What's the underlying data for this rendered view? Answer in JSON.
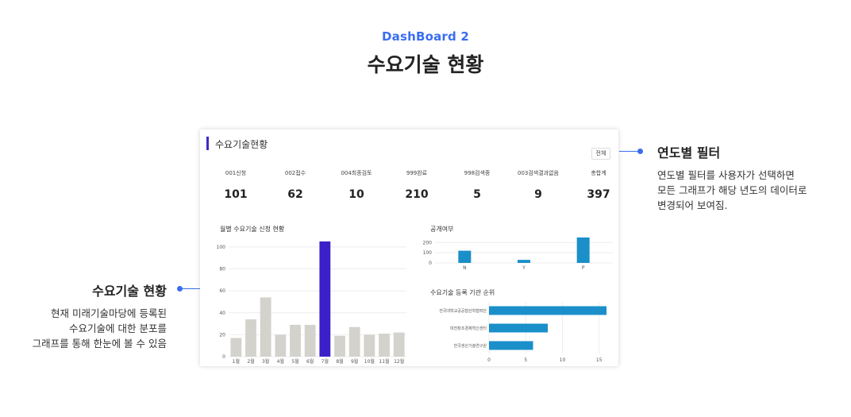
{
  "header": {
    "eyebrow": "DashBoard 2",
    "title": "수요기술 현황"
  },
  "card": {
    "title": "수요기술현황",
    "filter_label": "전체",
    "stats": [
      {
        "label": "001신청",
        "value": "101"
      },
      {
        "label": "002접수",
        "value": "62"
      },
      {
        "label": "004최종검토",
        "value": "10"
      },
      {
        "label": "999완료",
        "value": "210"
      },
      {
        "label": "998검색중",
        "value": "5"
      },
      {
        "label": "003검색결과없음",
        "value": "9"
      },
      {
        "label": "총합계",
        "value": "397"
      }
    ]
  },
  "colors": {
    "accent": "#3a6df0",
    "highlight_bar": "#3b1fc9",
    "gray_bar": "#d3d2cc",
    "blue_bar": "#1b8fc9"
  },
  "chart_data": [
    {
      "type": "bar",
      "title": "월별 수요기술 신청 현황",
      "categories": [
        "1월",
        "2월",
        "3월",
        "4월",
        "5월",
        "6월",
        "7월",
        "8월",
        "9월",
        "10월",
        "11월",
        "12월"
      ],
      "values": [
        17,
        34,
        54,
        20,
        29,
        29,
        105,
        19,
        27,
        20,
        21,
        22
      ],
      "highlight_index": 6,
      "yticks": [
        0,
        20,
        40,
        60,
        80,
        100
      ],
      "ylim": [
        0,
        105
      ],
      "grid": true
    },
    {
      "type": "bar",
      "title": "공개여부",
      "categories": [
        "N",
        "Y",
        "P"
      ],
      "values": [
        120,
        30,
        250
      ],
      "yticks": [
        0,
        100,
        200
      ],
      "ylim": [
        0,
        250
      ],
      "grid": true
    },
    {
      "type": "bar",
      "orientation": "horizontal",
      "title": "수요기술 등록 기관 순위",
      "categories": [
        "전국대학교공공협산학협력단",
        "대전창조경제혁신센터",
        "한국생산기술연구원"
      ],
      "values": [
        16,
        8,
        6
      ],
      "xticks": [
        0,
        5,
        10,
        15
      ],
      "xlim": [
        0,
        16
      ],
      "grid": true
    }
  ],
  "callouts": {
    "right": {
      "title": "연도별 필터",
      "lines": [
        "연도별 필터를 사용자가 선택하면",
        "모든 그래프가 해당 년도의 데이터로",
        "변경되어 보여짐."
      ]
    },
    "left": {
      "title": "수요기술 현황",
      "lines": [
        "현재 미래기술마당에 등록된",
        "수요기술에 대한 분포를",
        "그래프를 통해 한눈에 볼 수 있음"
      ]
    }
  }
}
